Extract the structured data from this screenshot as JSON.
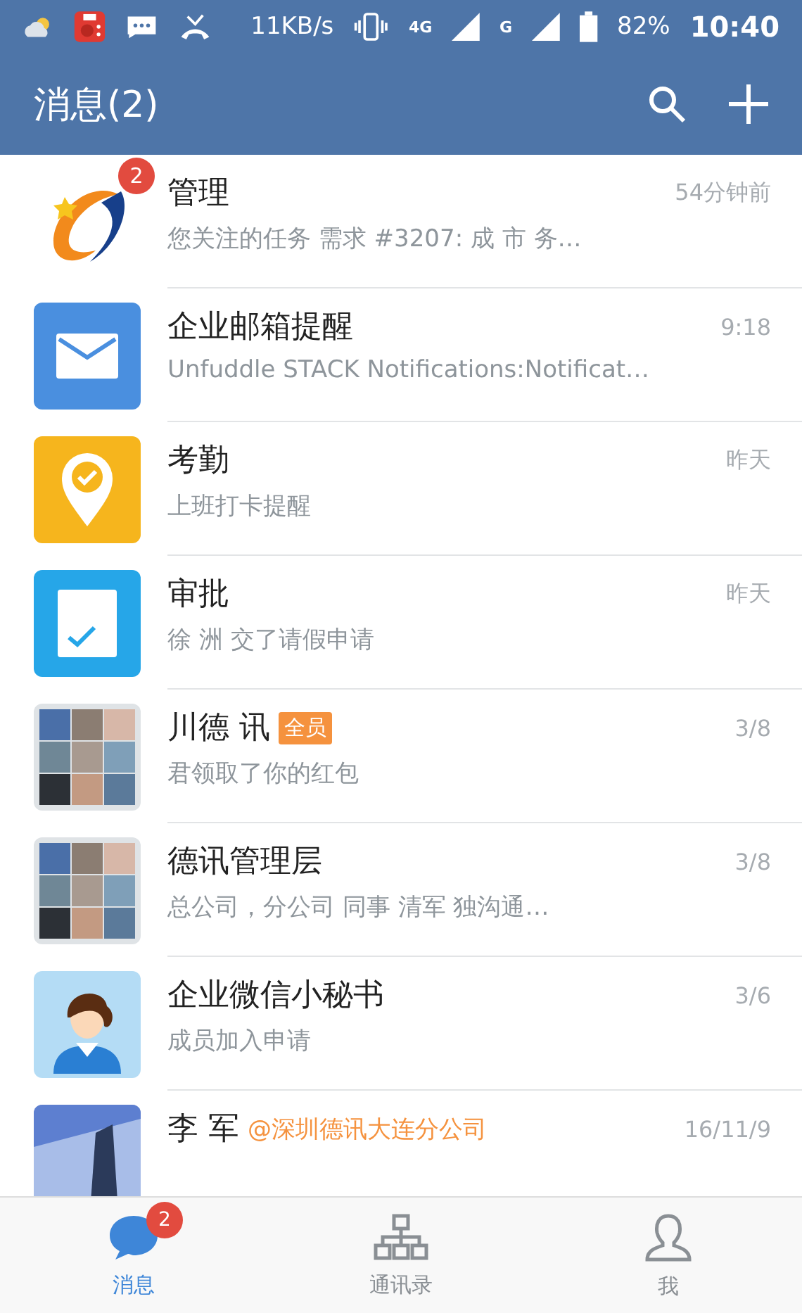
{
  "status_bar": {
    "speed": "11KB/s",
    "network": "4G",
    "network_2": "G",
    "battery": "82%",
    "time": "10:40"
  },
  "header": {
    "title": "消息(2)"
  },
  "conversations": [
    {
      "kind": "logo",
      "badge": "2",
      "title": "管理",
      "preview": "您关注的任务 需求 #3207: 成 市 务…",
      "time": "54分钟前"
    },
    {
      "kind": "mail",
      "title": "企业邮箱提醒",
      "preview": "Unfuddle STACK Notifications:Notificat…",
      "time": "9:18"
    },
    {
      "kind": "location",
      "title": "考勤",
      "preview": "上班打卡提醒",
      "time": "昨天"
    },
    {
      "kind": "approval",
      "title": "审批",
      "preview": "徐 洲 交了请假申请",
      "time": "昨天"
    },
    {
      "kind": "group",
      "title": "川德 讯",
      "tag": "全员",
      "preview": "君领取了你的红包",
      "time": "3/8"
    },
    {
      "kind": "group",
      "title": "德讯管理层",
      "preview": "总公司，分公司 同事 清军 独沟通…",
      "time": "3/8"
    },
    {
      "kind": "secretary",
      "title": "企业微信小秘书",
      "preview": "成员加入申请",
      "time": "3/6"
    },
    {
      "kind": "picture",
      "title": "李 军",
      "mention": "@深圳德讯大连分公司",
      "time": "16/11/9"
    }
  ],
  "tabs": [
    {
      "label": "消息",
      "kind": "chat",
      "selected": true,
      "badge": "2"
    },
    {
      "label": "通讯录",
      "kind": "org",
      "selected": false
    },
    {
      "label": "我",
      "kind": "person",
      "selected": false
    }
  ]
}
